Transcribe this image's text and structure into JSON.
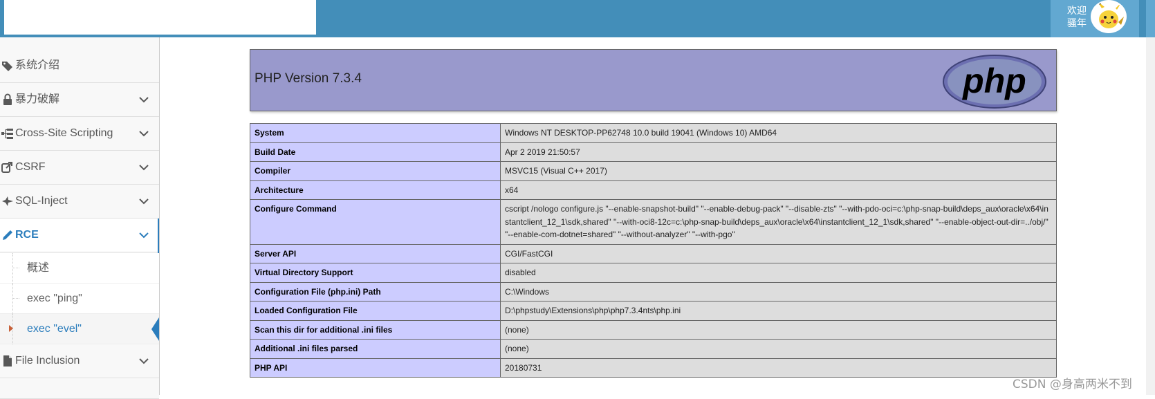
{
  "header": {
    "welcome_line1": "欢迎",
    "welcome_line2": "骚年",
    "colors": {
      "bar": "#438eb9",
      "user_area": "#62a8d1"
    }
  },
  "sidebar": {
    "items": [
      {
        "label": "系统介绍",
        "icon": "tags-icon"
      },
      {
        "label": "暴力破解",
        "icon": "lock-icon"
      },
      {
        "label": "Cross-Site Scripting",
        "icon": "sitemap-icon"
      },
      {
        "label": "CSRF",
        "icon": "share-icon"
      },
      {
        "label": "SQL-Inject",
        "icon": "fighter-jet-icon"
      },
      {
        "label": "RCE",
        "icon": "pencil-icon"
      },
      {
        "label": "File Inclusion",
        "icon": "file-icon"
      }
    ],
    "rce_children": [
      {
        "label": "概述"
      },
      {
        "label": "exec \"ping\""
      },
      {
        "label": "exec \"evel\""
      }
    ],
    "active_color": "#2b7dbc"
  },
  "phpinfo": {
    "version_title": "PHP Version 7.3.4",
    "logo_text": "php",
    "rows": [
      {
        "key": "System",
        "value": "Windows NT DESKTOP-PP62748 10.0 build 19041 (Windows 10) AMD64"
      },
      {
        "key": "Build Date",
        "value": "Apr 2 2019 21:50:57"
      },
      {
        "key": "Compiler",
        "value": "MSVC15 (Visual C++ 2017)"
      },
      {
        "key": "Architecture",
        "value": "x64"
      },
      {
        "key": "Configure Command",
        "value": "cscript /nologo configure.js \"--enable-snapshot-build\" \"--enable-debug-pack\" \"--disable-zts\" \"--with-pdo-oci=c:\\php-snap-build\\deps_aux\\oracle\\x64\\instantclient_12_1\\sdk,shared\" \"--with-oci8-12c=c:\\php-snap-build\\deps_aux\\oracle\\x64\\instantclient_12_1\\sdk,shared\" \"--enable-object-out-dir=../obj/\" \"--enable-com-dotnet=shared\" \"--without-analyzer\" \"--with-pgo\""
      },
      {
        "key": "Server API",
        "value": "CGI/FastCGI"
      },
      {
        "key": "Virtual Directory Support",
        "value": "disabled"
      },
      {
        "key": "Configuration File (php.ini) Path",
        "value": "C:\\Windows"
      },
      {
        "key": "Loaded Configuration File",
        "value": "D:\\phpstudy\\Extensions\\php\\php7.3.4nts\\php.ini"
      },
      {
        "key": "Scan this dir for additional .ini files",
        "value": "(none)"
      },
      {
        "key": "Additional .ini files parsed",
        "value": "(none)"
      },
      {
        "key": "PHP API",
        "value": "20180731"
      }
    ],
    "colors": {
      "header_bg": "#9999cc",
      "key_bg": "#ccccff",
      "value_bg": "#dddddd"
    }
  },
  "watermark": "CSDN @身高两米不到"
}
